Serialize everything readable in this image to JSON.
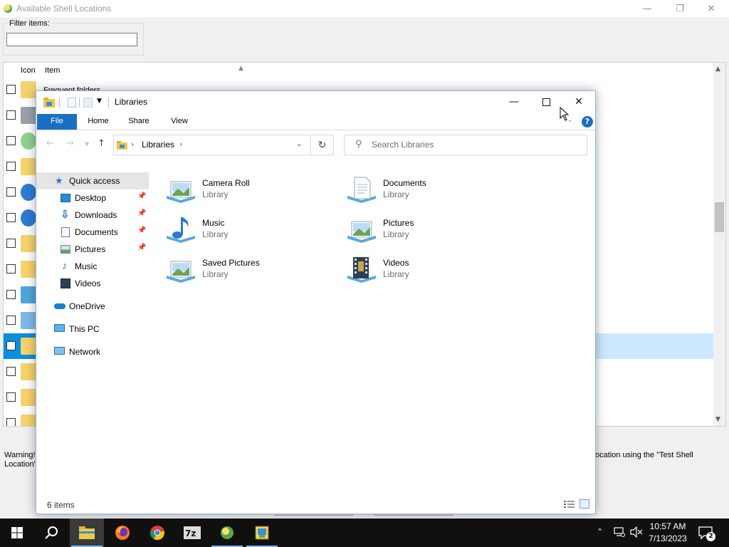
{
  "background_window": {
    "title": "Available Shell Locations",
    "filter_label": "Filter items:",
    "filter_value": "",
    "columns": {
      "icon": "Icon",
      "item": "Item"
    },
    "first_row_text": "Frequent folders",
    "warning_left": "Warning!",
    "warning_left_line2": "Location\"",
    "warning_right": "ocation using the \"Test Shell"
  },
  "explorer": {
    "title": "Libraries",
    "ribbon_tabs": [
      "File",
      "Home",
      "Share",
      "View"
    ],
    "address": {
      "path": "Libraries"
    },
    "search_placeholder": "Search Libraries",
    "nav": {
      "quick_access": "Quick access",
      "pinned": [
        {
          "label": "Desktop",
          "pinned": true
        },
        {
          "label": "Downloads",
          "pinned": true
        },
        {
          "label": "Documents",
          "pinned": true
        },
        {
          "label": "Pictures",
          "pinned": true
        },
        {
          "label": "Music",
          "pinned": false
        },
        {
          "label": "Videos",
          "pinned": false
        }
      ],
      "onedrive": "OneDrive",
      "this_pc": "This PC",
      "network": "Network"
    },
    "libraries": [
      {
        "name": "Camera Roll",
        "type": "Library",
        "icon": "pictures-library-icon"
      },
      {
        "name": "Documents",
        "type": "Library",
        "icon": "documents-library-icon"
      },
      {
        "name": "Music",
        "type": "Library",
        "icon": "music-library-icon"
      },
      {
        "name": "Pictures",
        "type": "Library",
        "icon": "pictures-library-icon"
      },
      {
        "name": "Saved Pictures",
        "type": "Library",
        "icon": "pictures-library-icon"
      },
      {
        "name": "Videos",
        "type": "Library",
        "icon": "videos-library-icon"
      }
    ],
    "status": "6 items"
  },
  "taskbar": {
    "time": "10:57 AM",
    "date": "7/13/2023",
    "notifications": "2"
  },
  "colors": {
    "accent": "#1a6fc3",
    "selection": "#cce8ff",
    "taskbar": "#101010"
  }
}
